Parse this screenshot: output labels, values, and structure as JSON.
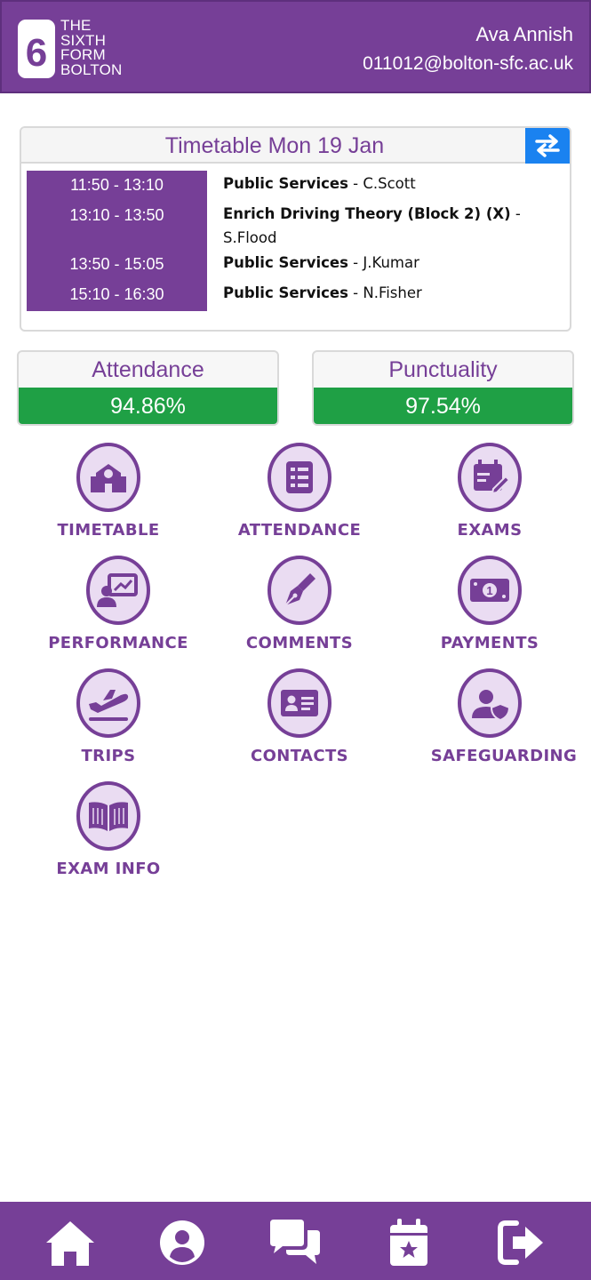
{
  "header": {
    "logo_numeral": "6",
    "logo_lines": [
      "THE",
      "SIXTH",
      "FORM",
      "BOLTON"
    ],
    "user_name": "Ava Annish",
    "user_email": "011012@bolton-sfc.ac.uk"
  },
  "timetable": {
    "title": "Timetable Mon 19 Jan",
    "switch_icon": "swap-arrows-icon",
    "lessons": [
      {
        "time": "11:50 - 13:10",
        "subject": "Public Services",
        "teacher": " - C.Scott"
      },
      {
        "time": "13:10 - 13:50",
        "subject": "Enrich Driving Theory (Block 2) (X)",
        "teacher": " - S.Flood"
      },
      {
        "time": "13:50 - 15:05",
        "subject": "Public Services",
        "teacher": " - J.Kumar"
      },
      {
        "time": "15:10 - 16:30",
        "subject": "Public Services",
        "teacher": " - N.Fisher"
      }
    ]
  },
  "stats": {
    "attendance": {
      "label": "Attendance",
      "value": "94.86%"
    },
    "punctuality": {
      "label": "Punctuality",
      "value": "97.54%"
    }
  },
  "menu": [
    {
      "label": "TIMETABLE",
      "icon": "school-building-icon"
    },
    {
      "label": "ATTENDANCE",
      "icon": "checklist-icon"
    },
    {
      "label": "EXAMS",
      "icon": "calendar-edit-icon"
    },
    {
      "label": "PERFORMANCE",
      "icon": "presentation-chart-icon"
    },
    {
      "label": "COMMENTS",
      "icon": "fountain-pen-icon"
    },
    {
      "label": "PAYMENTS",
      "icon": "money-bill-icon"
    },
    {
      "label": "TRIPS",
      "icon": "plane-departure-icon"
    },
    {
      "label": "CONTACTS",
      "icon": "id-card-icon"
    },
    {
      "label": "SAFEGUARDING",
      "icon": "user-shield-icon"
    },
    {
      "label": "EXAM INFO",
      "icon": "open-book-icon"
    }
  ],
  "bottom_nav": [
    {
      "icon": "home-icon"
    },
    {
      "icon": "user-circle-icon"
    },
    {
      "icon": "chat-bubbles-icon"
    },
    {
      "icon": "calendar-star-icon"
    },
    {
      "icon": "sign-out-icon"
    }
  ],
  "colors": {
    "brand_purple": "#763f97",
    "icon_fill": "#eadcf2",
    "accent_blue": "#1a82f0",
    "success_green": "#1fa045"
  }
}
